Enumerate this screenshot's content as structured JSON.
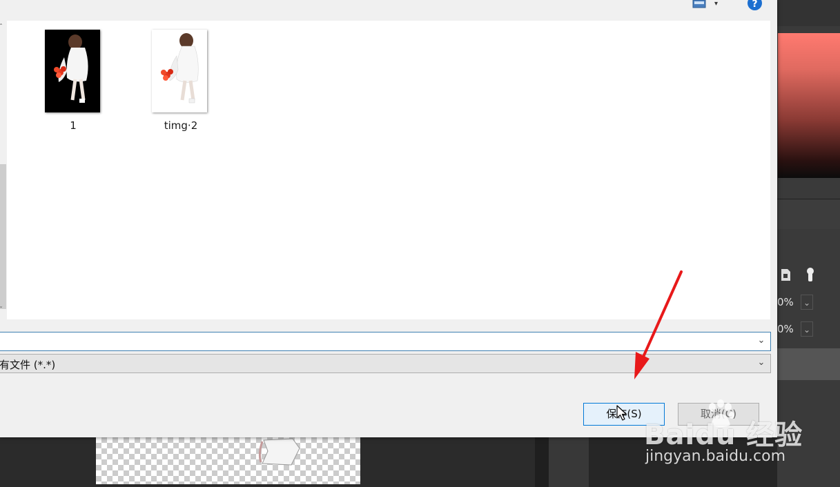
{
  "dialog": {
    "files": [
      {
        "label": "1",
        "thumb_bg": "#000000"
      },
      {
        "label": "timg·2",
        "thumb_bg": "#ffffff"
      }
    ],
    "filename_value": "",
    "filetype_value": "有文件 (*.*)",
    "save_label": "保存(S)",
    "cancel_label": "取消(C)",
    "help_glyph": "?"
  },
  "app_panel": {
    "opacity_value": "0%",
    "fill_value": "0%"
  },
  "watermark": {
    "logo_text": "Baidu 经验",
    "url_text": "jingyan.baidu.com"
  },
  "colors": {
    "accent_blue": "#0078d7",
    "annotation_red": "#e8191a"
  }
}
